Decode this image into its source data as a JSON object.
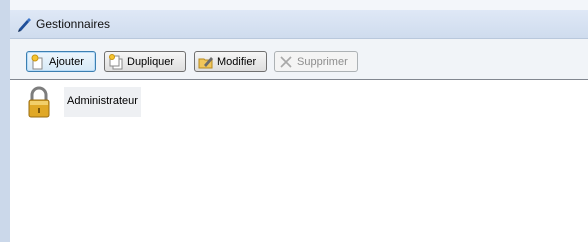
{
  "window": {
    "title": "Gestionnaires",
    "title_icon": "pen-icon"
  },
  "toolbar": {
    "buttons": [
      {
        "label": "Ajouter",
        "icon": "add-user-icon",
        "enabled": true
      },
      {
        "label": "Dupliquer",
        "icon": "duplicate-icon",
        "enabled": true
      },
      {
        "label": "Modifier",
        "icon": "edit-folder-icon",
        "enabled": true
      },
      {
        "label": "Supprimer",
        "icon": "delete-icon",
        "enabled": false
      }
    ]
  },
  "list": {
    "items": [
      {
        "label": "Administrateur",
        "icon": "lock-icon"
      }
    ]
  }
}
